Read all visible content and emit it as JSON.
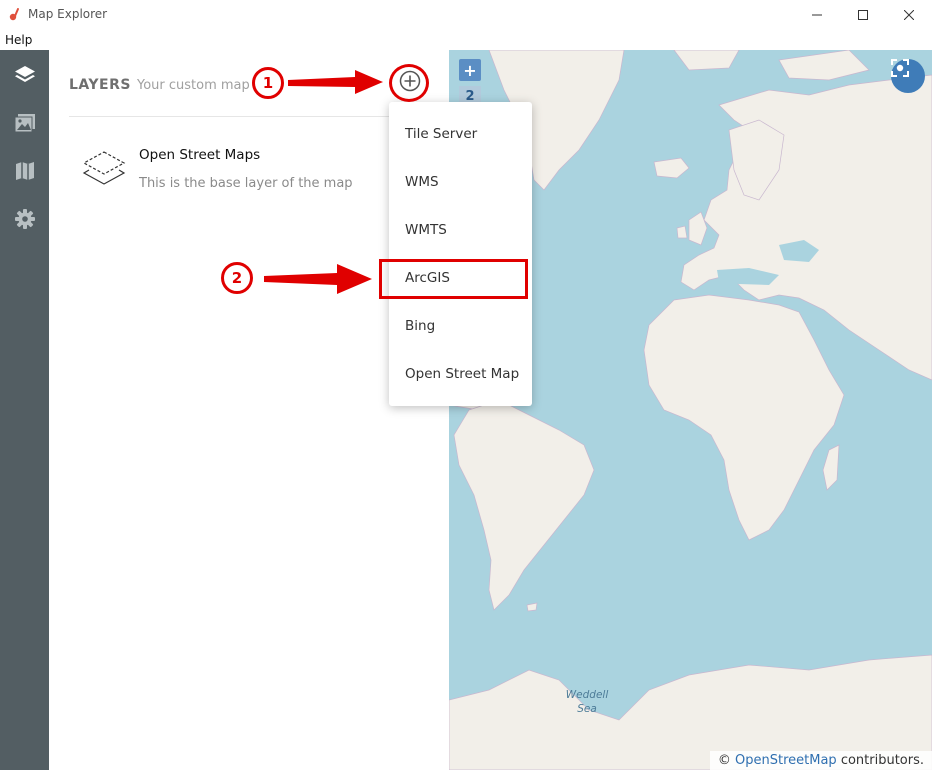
{
  "window": {
    "title": "Map Explorer",
    "help_menu": "Help"
  },
  "sidebar": {
    "items": [
      {
        "icon": "layers-icon",
        "active": true
      },
      {
        "icon": "images-icon",
        "active": false
      },
      {
        "icon": "map-icon",
        "active": false
      },
      {
        "icon": "gear-icon",
        "active": false
      }
    ]
  },
  "panel": {
    "title": "LAYERS",
    "subtitle": "Your custom map",
    "layers": [
      {
        "name": "Open Street Maps",
        "description": "This is the base layer of the map"
      }
    ]
  },
  "dropdown": {
    "items": [
      "Tile Server",
      "WMS",
      "WMTS",
      "ArcGIS",
      "Bing",
      "Open Street Map"
    ],
    "highlighted": "ArcGIS"
  },
  "map": {
    "zoom_in": "+",
    "zoom_level": "2",
    "sea_label_line1": "Weddell",
    "sea_label_line2": "Sea",
    "attribution_prefix": "©",
    "attribution_link": "OpenStreetMap",
    "attribution_suffix": "contributors."
  },
  "annotations": {
    "step1": "1",
    "step2": "2"
  },
  "colors": {
    "sidebar": "#535e63",
    "water": "#aad3df",
    "land": "#f2efe9",
    "annotation": "#e00000",
    "accent": "#3f7cb8"
  }
}
